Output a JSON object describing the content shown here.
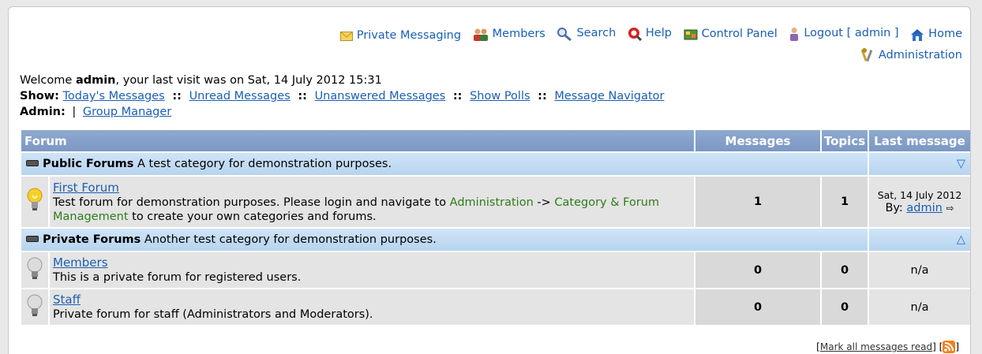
{
  "nav": {
    "items": [
      {
        "label": "Private Messaging",
        "icon": "envelope-icon"
      },
      {
        "label": "Members",
        "icon": "members-icon"
      },
      {
        "label": "Search",
        "icon": "search-icon"
      },
      {
        "label": "Help",
        "icon": "help-icon"
      },
      {
        "label": "Control Panel",
        "icon": "control-panel-icon"
      },
      {
        "label": "Logout [ admin ]",
        "icon": "logout-icon"
      },
      {
        "label": "Home",
        "icon": "home-icon"
      }
    ],
    "admin": {
      "label": "Administration",
      "icon": "tools-icon"
    }
  },
  "welcome": {
    "prefix": "Welcome ",
    "user": "admin",
    "suffix": ", your last visit was on Sat, 14 July 2012 15:31"
  },
  "show": {
    "label": "Show:",
    "sep": "::",
    "links": [
      "Today's Messages",
      "Unread Messages",
      "Unanswered Messages",
      "Show Polls",
      "Message Navigator"
    ]
  },
  "admin_bar": {
    "label": "Admin:",
    "pipe": "|",
    "link": "Group Manager"
  },
  "table": {
    "headers": {
      "forum": "Forum",
      "messages": "Messages",
      "topics": "Topics",
      "last": "Last message"
    },
    "categories": [
      {
        "name": "Public Forums",
        "desc": "A test category for demonstration purposes.",
        "toggle": "▽",
        "forums": [
          {
            "name": "First Forum",
            "desc_a": "Test forum for demonstration purposes. Please login and navigate to ",
            "desc_link1": "Administration",
            "desc_b": " -> ",
            "desc_link2": "Category & Forum Management",
            "desc_c": " to create your own categories and forums.",
            "messages": "1",
            "topics": "1",
            "last_date": "Sat, 14 July 2012",
            "last_by": "By:",
            "last_user": "admin"
          }
        ]
      },
      {
        "name": "Private Forums",
        "desc": "Another test category for demonstration purposes.",
        "toggle": "△",
        "forums": [
          {
            "name": "Members",
            "desc": "This is a private forum for registered users.",
            "messages": "0",
            "topics": "0",
            "last": "n/a"
          },
          {
            "name": "Staff",
            "desc": "Private forum for staff (Administrators and Moderators).",
            "messages": "0",
            "topics": "0",
            "last": "n/a"
          }
        ]
      }
    ]
  },
  "footer": {
    "open": "[ ",
    "mark_read": "Mark all messages read",
    "mid": " ] [ ",
    "close": " ]"
  },
  "colors": {
    "link": "#1a5fb4",
    "header": "#7b98c4",
    "category": "#c3dbf2",
    "green_link": "#2e7d1a"
  }
}
